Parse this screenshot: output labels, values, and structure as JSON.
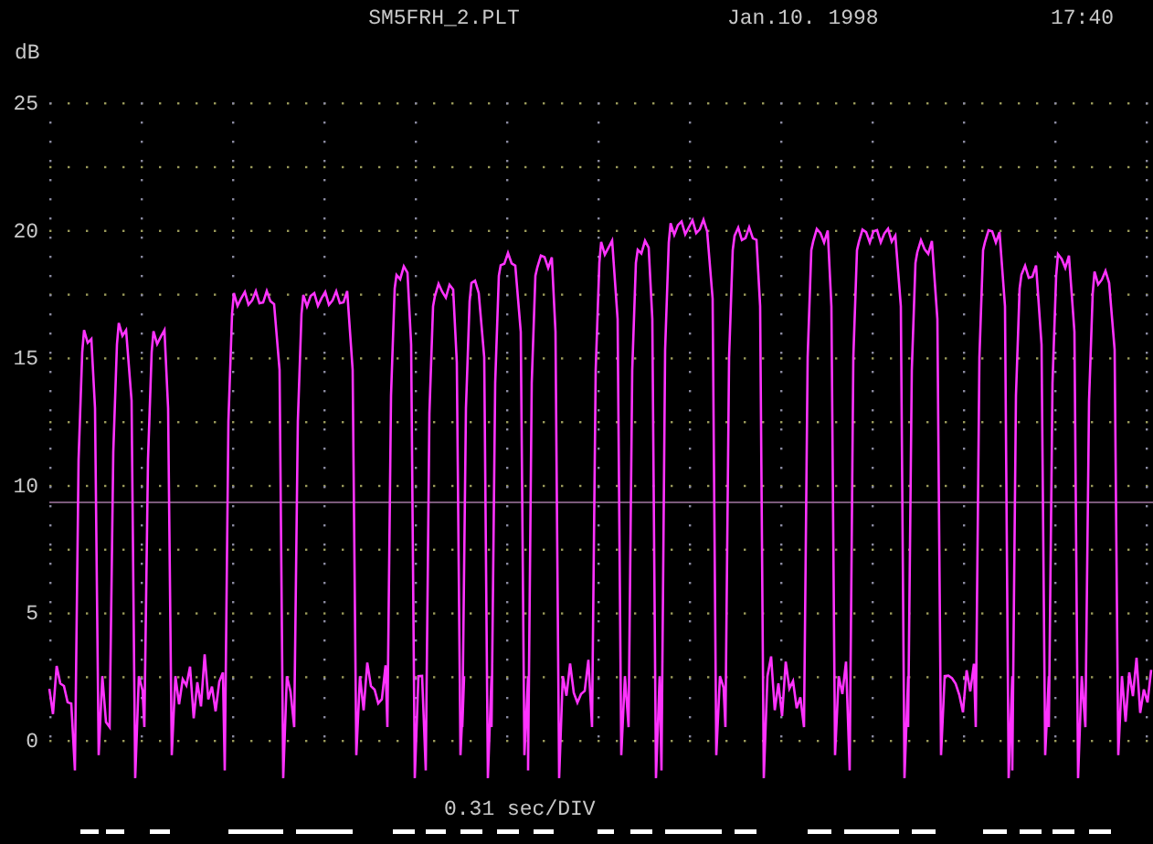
{
  "header": {
    "filename": "SM5FRH_2.PLT",
    "date": "Jan.10. 1998",
    "time": "17:40"
  },
  "y_axis": {
    "unit": "dB",
    "tick_labels": [
      "25",
      "20",
      "15",
      "10",
      "5",
      "0"
    ]
  },
  "x_axis": {
    "label": "0.31 sec/DIV"
  }
}
